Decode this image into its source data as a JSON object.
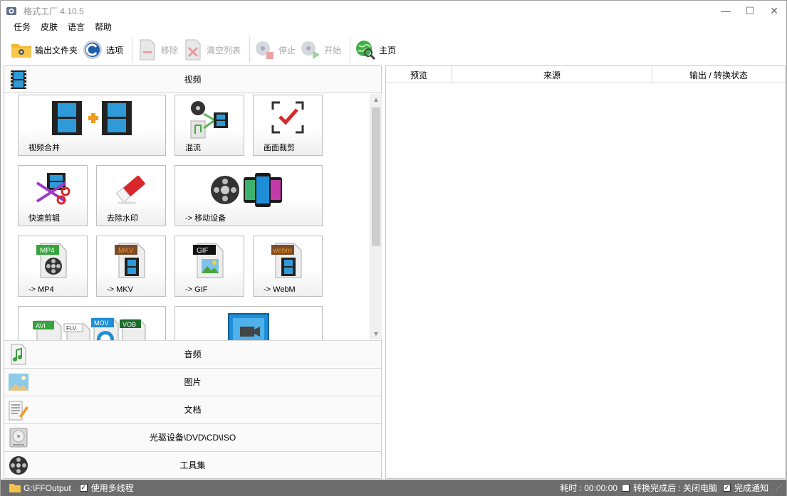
{
  "window": {
    "title": "格式工厂 4.10.5",
    "minimize": "—",
    "maximize": "☐",
    "close": "✕"
  },
  "menu": [
    "任务",
    "皮肤",
    "语言",
    "帮助"
  ],
  "toolbar": {
    "output_folder": "输出文件夹",
    "options": "选项",
    "remove": "移除",
    "clear_list": "清空列表",
    "stop": "停止",
    "start": "开始",
    "home": "主页"
  },
  "categories": {
    "video": "视频",
    "audio": "音频",
    "image": "图片",
    "document": "文档",
    "rom": "光驱设备\\DVD\\CD\\ISO",
    "tools": "工具集"
  },
  "video_tiles": {
    "merge": "视频合并",
    "mux": "混流",
    "crop": "画面裁剪",
    "quick_clip": "快速剪辑",
    "remove_watermark": "去除水印",
    "mobile": "-> 移动设备",
    "mp4": "-> MP4",
    "mkv": "-> MKV",
    "gif": "-> GIF",
    "webm": "-> WebM",
    "mp4_badge": "MP4",
    "mkv_badge": "MKV",
    "gif_badge": "GIF",
    "webm_badge": "webm",
    "fmt_badges": [
      "AVI",
      "FLV",
      "MOV",
      "VOB"
    ]
  },
  "task_table": {
    "col_preview": "预览",
    "col_source": "来源",
    "col_status": "输出 / 转换状态"
  },
  "status": {
    "output_path": "G:\\FFOutput",
    "multithread": "使用多线程",
    "elapsed": "耗时 : 00:00:00",
    "after_convert": "转换完成后 : 关闭电脑",
    "notify": "完成通知"
  },
  "colors": {
    "statusbar": "#6d6d6d",
    "accent_blue": "#1e8fd6",
    "film_orange": "#f39a1c"
  }
}
